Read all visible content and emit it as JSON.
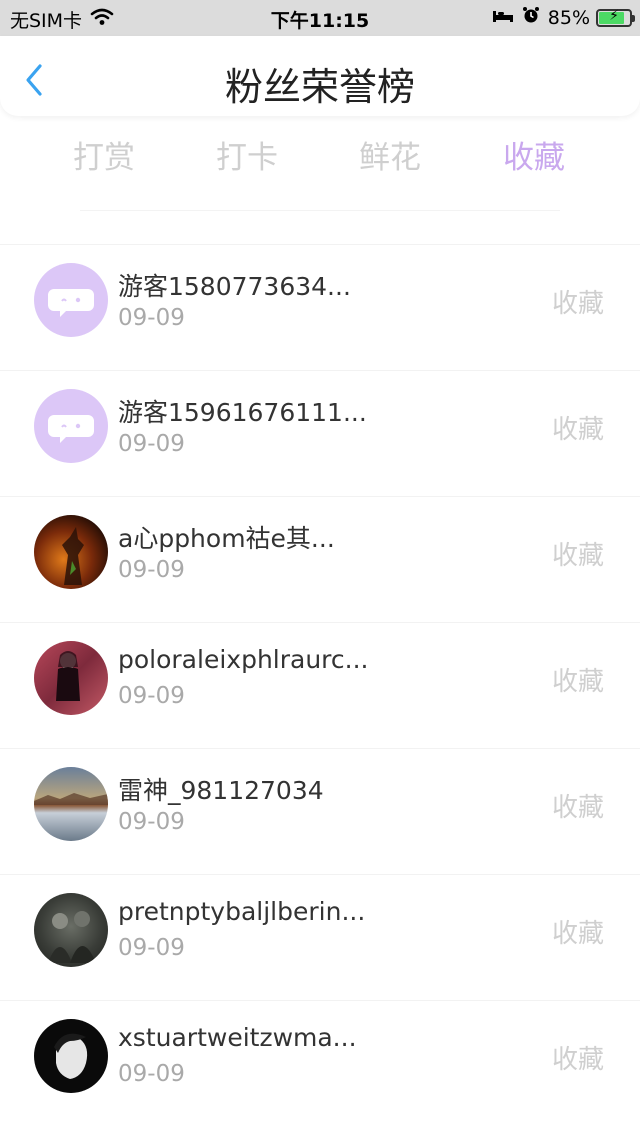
{
  "status_bar": {
    "carrier": "无SIM卡",
    "time": "下午11:15",
    "battery": "85%",
    "battery_level": 0.85
  },
  "nav": {
    "title": "粉丝荣誉榜"
  },
  "tabs": [
    {
      "label": "打赏"
    },
    {
      "label": "打卡"
    },
    {
      "label": "鲜花"
    },
    {
      "label": "收藏"
    }
  ],
  "active_tab": "收藏",
  "colors": {
    "accent": "#c9a8ee",
    "back": "#3aa3f0",
    "tab_inactive": "#cfcfcf"
  },
  "fans": [
    {
      "name": "游客1580773634...",
      "date": "09-09",
      "action": "收藏",
      "avatar": "guest-avatar"
    },
    {
      "name": "游客15961676111...",
      "date": "09-09",
      "action": "收藏",
      "avatar": "guest-avatar"
    },
    {
      "name": "a心pphom祜e其...",
      "date": "09-09",
      "action": "收藏",
      "avatar": "photo-avatar"
    },
    {
      "name": "poloraleixphlraurc...",
      "date": "09-09",
      "action": "收藏",
      "avatar": "photo-avatar"
    },
    {
      "name": "雷神_981127034",
      "date": "09-09",
      "action": "收藏",
      "avatar": "photo-avatar"
    },
    {
      "name": "pretnptybaljlberin...",
      "date": "09-09",
      "action": "收藏",
      "avatar": "photo-avatar"
    },
    {
      "name": "xstuartweitzwma...",
      "date": "09-09",
      "action": "收藏",
      "avatar": "photo-avatar"
    }
  ]
}
